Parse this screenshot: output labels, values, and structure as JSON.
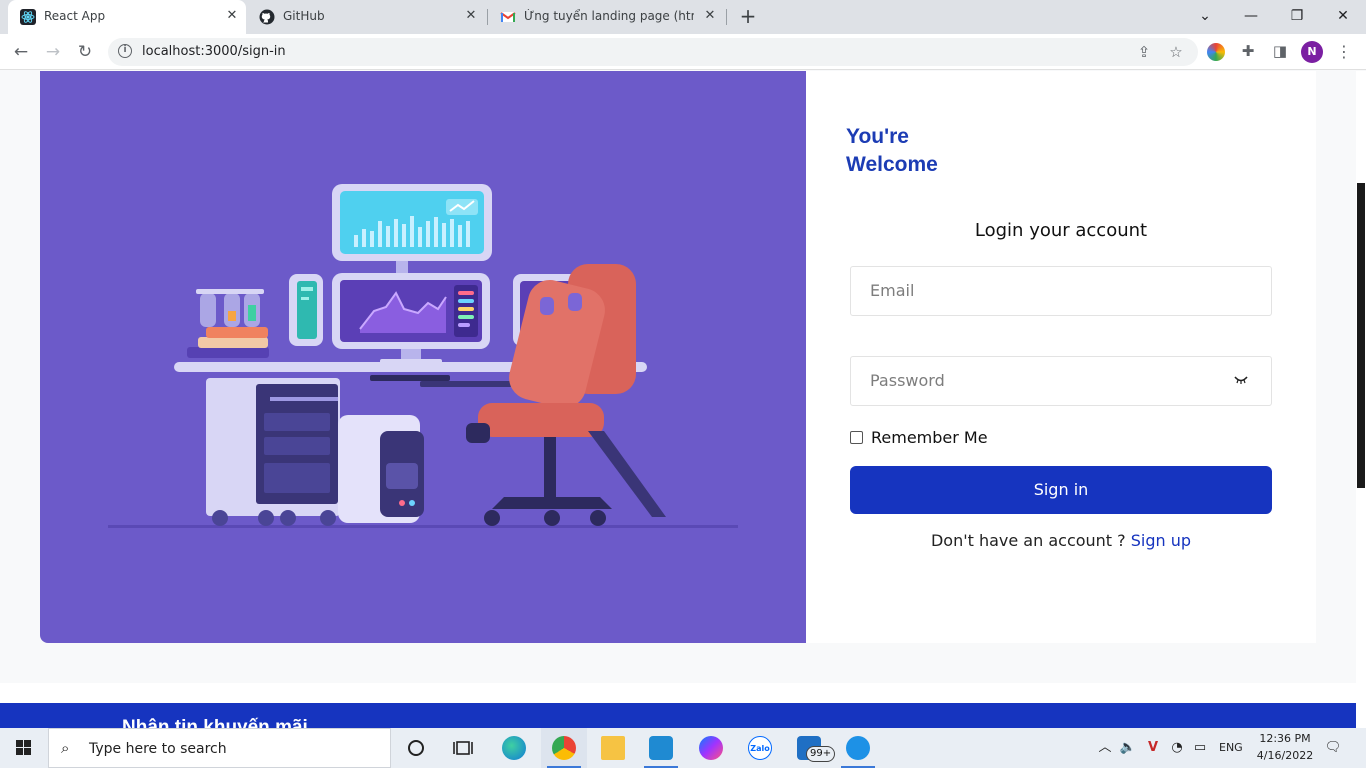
{
  "browser": {
    "tabs": [
      {
        "title": "React App",
        "favicon": "react-icon",
        "active": true
      },
      {
        "title": "GitHub",
        "favicon": "github-icon",
        "active": false
      },
      {
        "title": "Ứng tuyển landing page (html +",
        "favicon": "gmail-icon",
        "active": false
      }
    ],
    "url": "localhost:3000/sign-in",
    "profile_initial": "N"
  },
  "login": {
    "welcome_line1": "You're",
    "welcome_line2": "Welcome",
    "heading": "Login your account",
    "email_placeholder": "Email",
    "password_placeholder": "Password",
    "remember_label": "Remember Me",
    "remember_checked": false,
    "signin_label": "Sign in",
    "signup_prompt": "Don't have an account ?",
    "signup_link": "Sign up"
  },
  "footer": {
    "title": "Nhận tin khuyến mãi"
  },
  "taskbar": {
    "search_placeholder": "Type here to search",
    "mail_badge": "99+",
    "language": "ENG",
    "time": "12:36 PM",
    "date": "4/16/2022"
  },
  "colors": {
    "accent": "#1634bf",
    "illustration_bg": "#6c5ac9",
    "heading_blue": "#1c3cb4"
  }
}
